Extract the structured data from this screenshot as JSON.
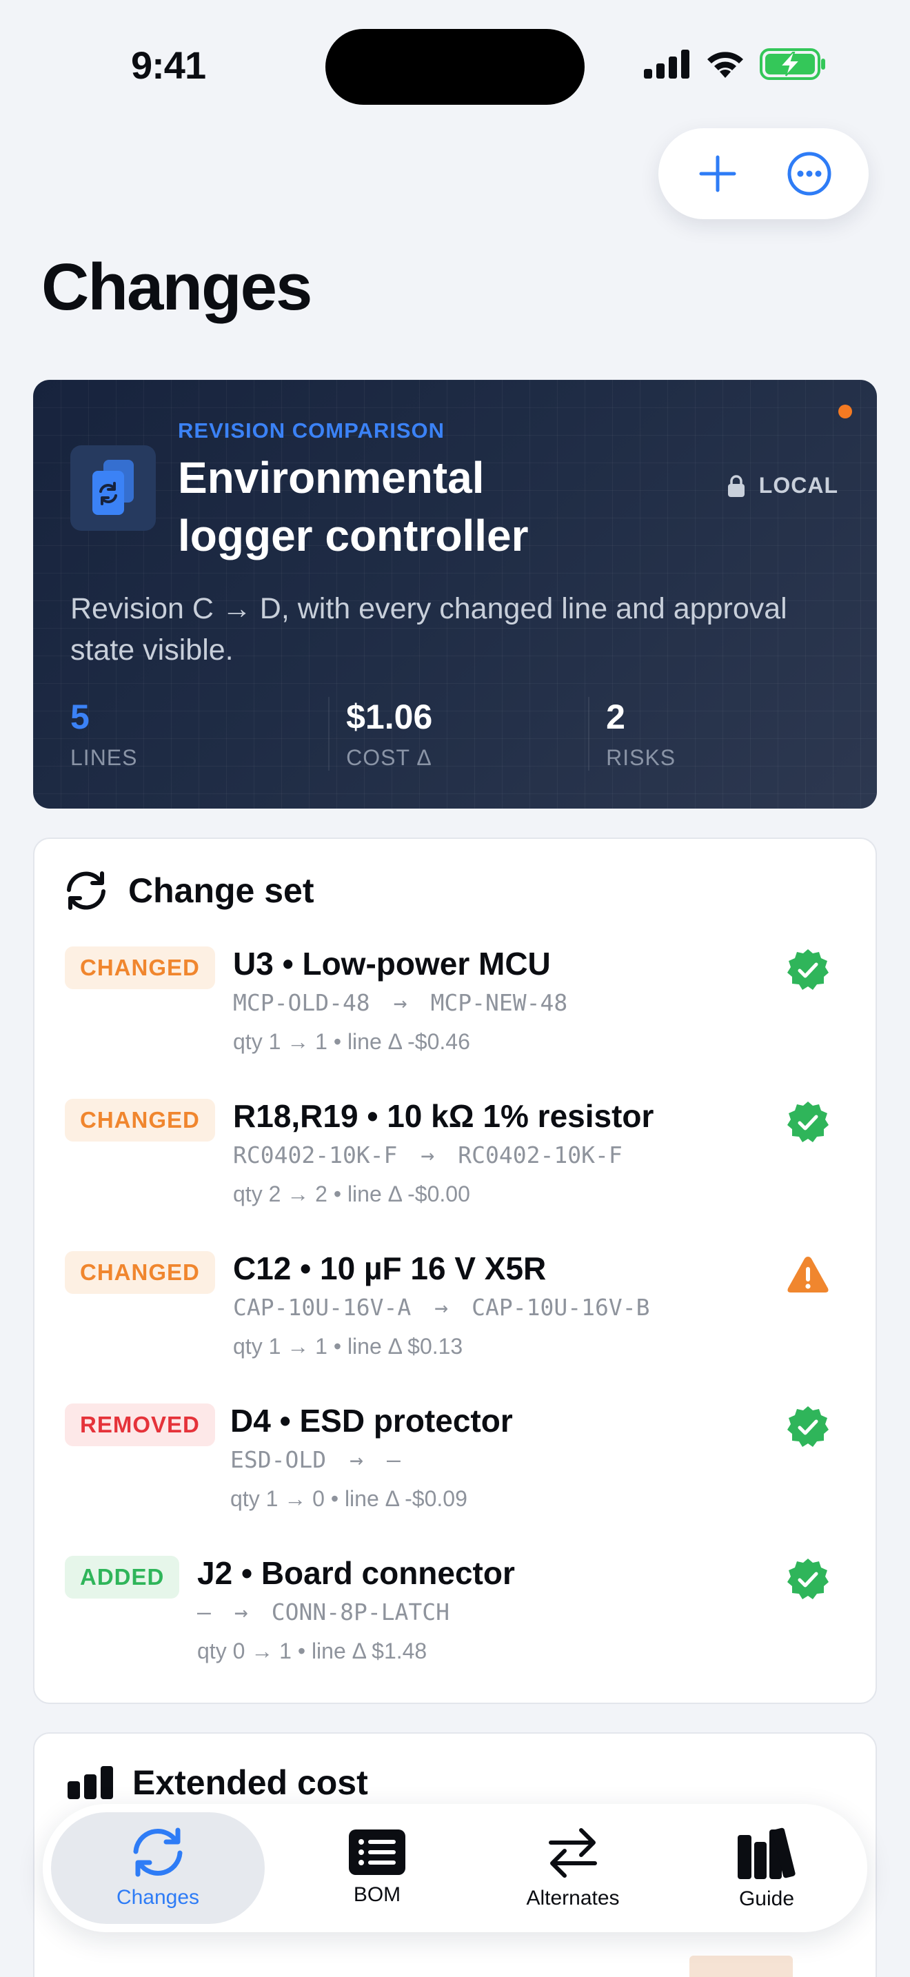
{
  "status_bar": {
    "time": "9:41"
  },
  "header": {
    "title": "Changes"
  },
  "hero": {
    "eyebrow": "REVISION COMPARISON",
    "title": "Environmental logger controller",
    "lock_label": "LOCAL",
    "subtitle": "Revision C → D, with every changed line and approval state visible.",
    "stats": [
      {
        "value": "5",
        "label": "LINES"
      },
      {
        "value": "$1.06",
        "label": "COST Δ"
      },
      {
        "value": "2",
        "label": "RISKS"
      }
    ]
  },
  "change_set": {
    "title": "Change set",
    "rows": [
      {
        "badge": "CHANGED",
        "title": "U3 • Low-power MCU",
        "from": "MCP-OLD-48",
        "arrow": "→",
        "to": "MCP-NEW-48",
        "qty": "qty 1 → 1 • line Δ -$0.46",
        "status": "approved"
      },
      {
        "badge": "CHANGED",
        "title": "R18,R19 • 10 kΩ 1% resistor",
        "from": "RC0402-10K-F",
        "arrow": "→",
        "to": "RC0402-10K-F",
        "qty": "qty 2 → 2 • line Δ -$0.00",
        "status": "approved"
      },
      {
        "badge": "CHANGED",
        "title": "C12 • 10 µF 16 V X5R",
        "from": "CAP-10U-16V-A",
        "arrow": "→",
        "to": "CAP-10U-16V-B",
        "qty": "qty 1 → 1 • line Δ $0.13",
        "status": "warning"
      },
      {
        "badge": "REMOVED",
        "title": "D4 • ESD protector",
        "from": "ESD-OLD",
        "arrow": "→",
        "to": "—",
        "qty": "qty 1 → 0 • line Δ -$0.09",
        "status": "approved"
      },
      {
        "badge": "ADDED",
        "title": "J2 • Board connector",
        "from": "—",
        "arrow": "→",
        "to": "CONN-8P-LATCH",
        "qty": "qty 0 → 1 • line Δ $1.48",
        "status": "approved"
      }
    ]
  },
  "extended_cost": {
    "title": "Extended cost"
  },
  "tabbar": {
    "tabs": [
      {
        "label": "Changes",
        "icon": "refresh-icon",
        "active": true
      },
      {
        "label": "BOM",
        "icon": "list-icon",
        "active": false
      },
      {
        "label": "Alternates",
        "icon": "swap-arrows-icon",
        "active": false
      },
      {
        "label": "Guide",
        "icon": "books-icon",
        "active": false
      }
    ]
  },
  "colors": {
    "accent": "#2e7cf6",
    "changed": "#f0862e",
    "removed": "#e5333a",
    "added": "#2fb55a",
    "hero_bg": "#1b2740"
  }
}
